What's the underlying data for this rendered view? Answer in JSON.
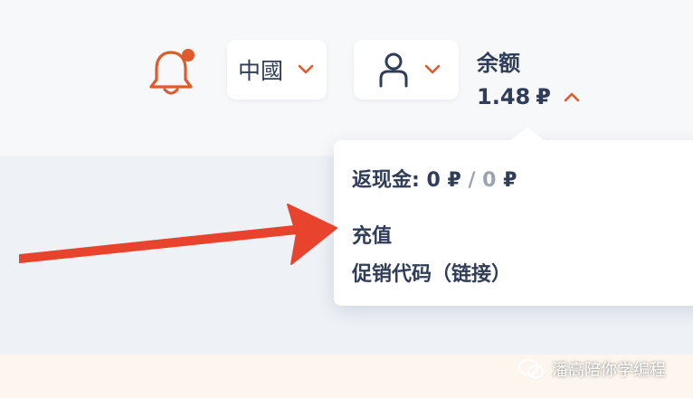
{
  "header": {
    "country_selector": {
      "label": "中國"
    },
    "balance": {
      "label": "余额",
      "amount": "1.48",
      "currency": "₽"
    }
  },
  "dropdown": {
    "cashback": {
      "label": "返现金:",
      "value_a": "0",
      "currency_a": "₽",
      "separator": "/",
      "value_b": "0",
      "currency_b": "₽"
    },
    "items": [
      {
        "label": "充值"
      },
      {
        "label": "促销代码（链接）"
      }
    ]
  },
  "watermark": {
    "text": "潘高陪你学编程"
  },
  "icons": {
    "bell": "bell-icon",
    "chevron": "chevron-down-icon",
    "user": "user-icon",
    "chevron_up": "chevron-up-icon"
  },
  "colors": {
    "accent": "#e05a2b",
    "text": "#2f3d59",
    "muted": "#9aa3b2",
    "notification_dot": "#e05a2b",
    "arrow": "#e8432d"
  }
}
